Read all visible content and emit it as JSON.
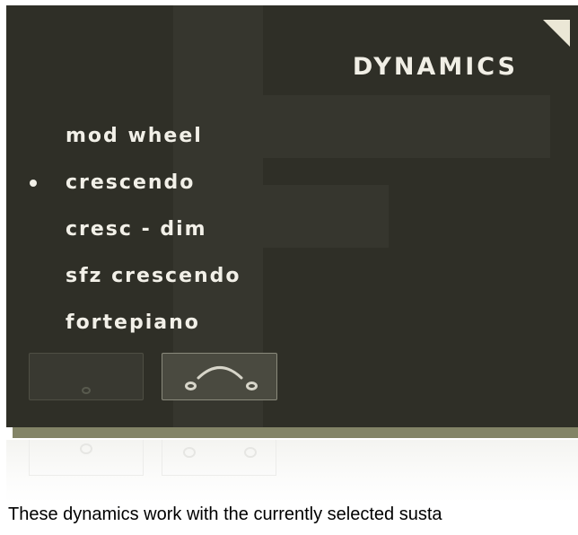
{
  "panel": {
    "title": "DYNAMICS",
    "menu": [
      {
        "label": "mod wheel",
        "selected": false
      },
      {
        "label": "crescendo",
        "selected": true
      },
      {
        "label": "cresc - dim",
        "selected": false
      },
      {
        "label": "sfz crescendo",
        "selected": false
      },
      {
        "label": "fortepiano",
        "selected": false
      }
    ],
    "buttons": {
      "single_icon": "single-note-icon",
      "legato_icon": "legato-slur-icon",
      "active": "legato"
    },
    "colors": {
      "panel_bg": "#2f2f27",
      "shadow": "#838467",
      "text": "#f2f0e8",
      "corner": "#ebe7d6"
    }
  },
  "caption": "These dynamics work with the currently selected susta"
}
